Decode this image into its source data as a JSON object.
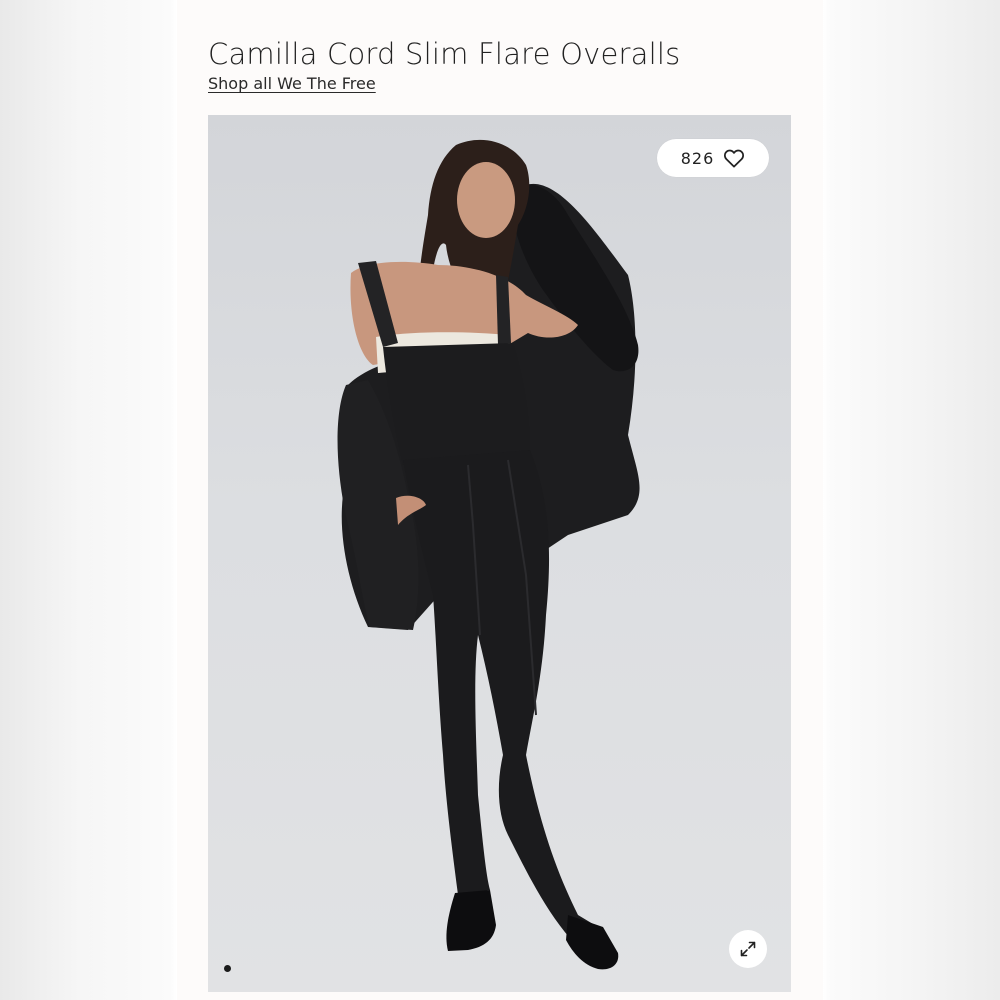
{
  "product": {
    "title": "Camilla Cord Slim Flare Overalls",
    "shop_link": "Shop all We The Free"
  },
  "gallery": {
    "like_count": "826",
    "icons": {
      "like": "heart-icon",
      "expand": "expand-icon"
    },
    "active_slide": 1,
    "slide_count": 1
  },
  "colors": {
    "background": "#fdfbfa",
    "text": "#222222",
    "photo_backdrop": "#d8dadd",
    "garment": "#1c1c1e",
    "pill": "#ffffff"
  }
}
